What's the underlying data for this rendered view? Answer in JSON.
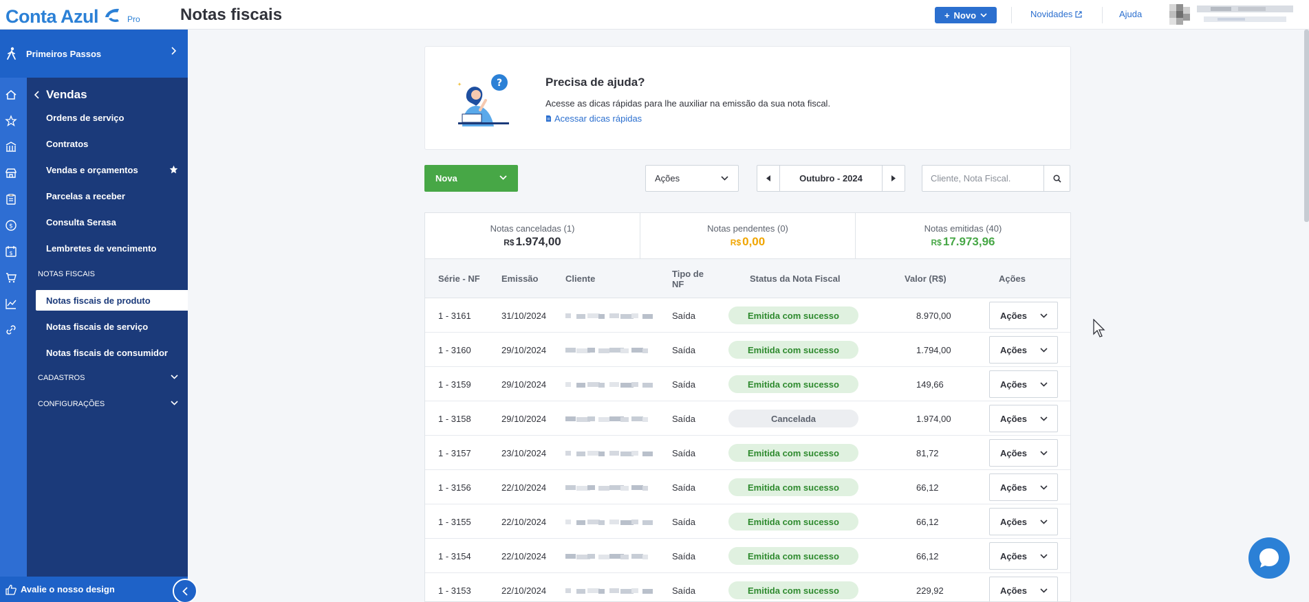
{
  "app": {
    "logo_text": "Conta Azul",
    "logo_badge": "Pro",
    "page_title": "Notas fiscais",
    "brand_color": "#2b80d6"
  },
  "topbar": {
    "new_button": "Novo",
    "news_link": "Novidades",
    "help_link": "Ajuda"
  },
  "sidebar": {
    "first_steps": "Primeiros Passos",
    "section_title": "Vendas",
    "items": [
      {
        "label": "Ordens de serviço"
      },
      {
        "label": "Contratos"
      },
      {
        "label": "Vendas e orçamentos"
      },
      {
        "label": "Parcelas a receber"
      },
      {
        "label": "Consulta Serasa"
      },
      {
        "label": "Lembretes de vencimento"
      }
    ],
    "fiscal_header": "NOTAS FISCAIS",
    "fiscal_items": [
      {
        "label": "Notas fiscais de produto",
        "active": true
      },
      {
        "label": "Notas fiscais de serviço"
      },
      {
        "label": "Notas fiscais de consumidor"
      }
    ],
    "cadastros": "CADASTROS",
    "configuracoes": "CONFIGURAÇÕES",
    "rate_design": "Avalie o nosso design"
  },
  "help": {
    "title": "Precisa de ajuda?",
    "description": "Acesse as dicas rápidas para lhe auxiliar na emissão da sua nota fiscal.",
    "link": "Acessar dicas rápidas"
  },
  "toolbar": {
    "new_label": "Nova",
    "actions_label": "Ações",
    "month": "Outubro - 2024",
    "search_placeholder": "Cliente, Nota Fiscal."
  },
  "summary": [
    {
      "label": "Notas canceladas (1)",
      "currency": "R$",
      "value": "1.974,00",
      "color": "#30323a"
    },
    {
      "label": "Notas pendentes (0)",
      "currency": "R$",
      "value": "0,00",
      "color": "#f0a500"
    },
    {
      "label": "Notas emitidas (40)",
      "currency": "R$",
      "value": "17.973,96",
      "color": "#47a746"
    }
  ],
  "table": {
    "headers": {
      "serie": "Série - NF",
      "emissao": "Emissão",
      "cliente": "Cliente",
      "tipo": "Tipo de NF",
      "status": "Status da Nota Fiscal",
      "valor": "Valor (R$)",
      "acoes": "Ações"
    },
    "rows": [
      {
        "serie": "1 - 3161",
        "emissao": "31/10/2024",
        "tipo": "Saída",
        "status": "Emitida com sucesso",
        "status_type": "ok",
        "valor": "8.970,00",
        "acoes": "Ações"
      },
      {
        "serie": "1 - 3160",
        "emissao": "29/10/2024",
        "tipo": "Saída",
        "status": "Emitida com sucesso",
        "status_type": "ok",
        "valor": "1.794,00",
        "acoes": "Ações"
      },
      {
        "serie": "1 - 3159",
        "emissao": "29/10/2024",
        "tipo": "Saída",
        "status": "Emitida com sucesso",
        "status_type": "ok",
        "valor": "149,66",
        "acoes": "Ações"
      },
      {
        "serie": "1 - 3158",
        "emissao": "29/10/2024",
        "tipo": "Saída",
        "status": "Cancelada",
        "status_type": "cancel",
        "valor": "1.974,00",
        "acoes": "Ações"
      },
      {
        "serie": "1 - 3157",
        "emissao": "23/10/2024",
        "tipo": "Saída",
        "status": "Emitida com sucesso",
        "status_type": "ok",
        "valor": "81,72",
        "acoes": "Ações"
      },
      {
        "serie": "1 - 3156",
        "emissao": "22/10/2024",
        "tipo": "Saída",
        "status": "Emitida com sucesso",
        "status_type": "ok",
        "valor": "66,12",
        "acoes": "Ações"
      },
      {
        "serie": "1 - 3155",
        "emissao": "22/10/2024",
        "tipo": "Saída",
        "status": "Emitida com sucesso",
        "status_type": "ok",
        "valor": "66,12",
        "acoes": "Ações"
      },
      {
        "serie": "1 - 3154",
        "emissao": "22/10/2024",
        "tipo": "Saída",
        "status": "Emitida com sucesso",
        "status_type": "ok",
        "valor": "66,12",
        "acoes": "Ações"
      },
      {
        "serie": "1 - 3153",
        "emissao": "22/10/2024",
        "tipo": "Saída",
        "status": "Emitida com sucesso",
        "status_type": "ok",
        "valor": "229,92",
        "acoes": "Ações"
      }
    ]
  }
}
